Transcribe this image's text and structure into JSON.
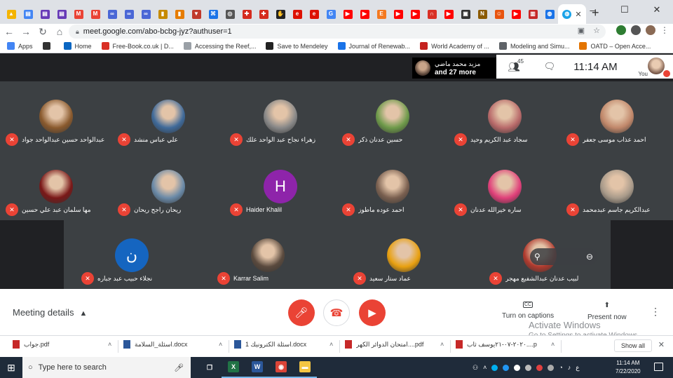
{
  "browser": {
    "tab_favicons": [
      {
        "icon": "drive-icon",
        "color": "#f4b400",
        "char": "▲"
      },
      {
        "icon": "form-icon",
        "color": "#4285f4",
        "char": "▤"
      },
      {
        "icon": "forms-icon",
        "color": "#673ab7",
        "char": "▤"
      },
      {
        "icon": "forms-icon",
        "color": "#673ab7",
        "char": "▤"
      },
      {
        "icon": "gmail-icon",
        "color": "#ea4335",
        "char": "M"
      },
      {
        "icon": "gmail-icon",
        "color": "#ea4335",
        "char": "M"
      },
      {
        "icon": "meet-link-icon",
        "color": "#4a67d6",
        "char": "∞"
      },
      {
        "icon": "meet-link-icon",
        "color": "#4a67d6",
        "char": "∞"
      },
      {
        "icon": "meet-link-icon",
        "color": "#4a67d6",
        "char": "∞"
      },
      {
        "icon": "slides-icon",
        "color": "#c68a00",
        "char": "▮"
      },
      {
        "icon": "bars-icon",
        "color": "#e67c00",
        "char": "▮"
      },
      {
        "icon": "shield-icon",
        "color": "#c0392b",
        "char": "▼"
      },
      {
        "icon": "grid-icon",
        "color": "#1a73e8",
        "char": "⌘"
      },
      {
        "icon": "globe-icon",
        "color": "#555555",
        "char": "◎"
      },
      {
        "icon": "canada-flag-icon",
        "color": "#d52b1e",
        "char": "✚"
      },
      {
        "icon": "canada-flag-icon",
        "color": "#d52b1e",
        "char": "✚"
      },
      {
        "icon": "hand-icon",
        "color": "#222222",
        "char": "✋"
      },
      {
        "icon": "wolfram-icon",
        "color": "#dd1100",
        "char": "e"
      },
      {
        "icon": "wolfram-icon",
        "color": "#dd1100",
        "char": "e"
      },
      {
        "icon": "google-icon",
        "color": "#4285f4",
        "char": "G"
      },
      {
        "icon": "youtube-icon",
        "color": "#ff0000",
        "char": "▶"
      },
      {
        "icon": "youtube-icon",
        "color": "#ff0000",
        "char": "▶"
      },
      {
        "icon": "elsevier-icon",
        "color": "#f47920",
        "char": "E"
      },
      {
        "icon": "youtube-icon",
        "color": "#ff0000",
        "char": "▶"
      },
      {
        "icon": "youtube-icon",
        "color": "#ff0000",
        "char": "▶"
      },
      {
        "icon": "arch-icon",
        "color": "#d93025",
        "char": "∩"
      },
      {
        "icon": "youtube-icon",
        "color": "#ff0000",
        "char": "▶"
      },
      {
        "icon": "lock-icon",
        "color": "#333333",
        "char": "▣"
      },
      {
        "icon": "n-icon",
        "color": "#8b5a00",
        "char": "N"
      },
      {
        "icon": "face-icon",
        "color": "#e8540f",
        "char": "☺"
      },
      {
        "icon": "youtube-icon",
        "color": "#ff0000",
        "char": "▶"
      },
      {
        "icon": "book-icon",
        "color": "#c62828",
        "char": "▥"
      },
      {
        "icon": "globe-icon",
        "color": "#1a73e8",
        "char": "◍"
      }
    ],
    "active_tab_favicon": {
      "icon": "chrome-globe-icon",
      "color": "#1aa3e8",
      "char": "◍"
    },
    "url": "meet.google.com/abo-bcbg-jyz?authuser=1",
    "bookmarks": [
      {
        "label": "Apps",
        "icon": "apps-icon",
        "color": "#4285f4"
      },
      {
        "label": "",
        "icon": "world-icon",
        "color": "#333333"
      },
      {
        "label": "Home",
        "icon": "linkedin-icon",
        "color": "#0a66c2"
      },
      {
        "label": "Free-Book.co.uk | D...",
        "icon": "star-icon",
        "color": "#d93025"
      },
      {
        "label": "Accessing the Reef,...",
        "icon": "page-icon",
        "color": "#9aa0a6"
      },
      {
        "label": "Save to Mendeley",
        "icon": "mendeley-icon",
        "color": "#222222"
      },
      {
        "label": "Journal of Renewab...",
        "icon": "journal-icon",
        "color": "#1a73e8"
      },
      {
        "label": "World Academy of ...",
        "icon": "w-icon",
        "color": "#c5221f"
      },
      {
        "label": "Modeling and Simu...",
        "icon": "doc-icon",
        "color": "#5f6368"
      },
      {
        "label": "OATD – Open Acce...",
        "icon": "oatd-icon",
        "color": "#e37400"
      }
    ]
  },
  "meet": {
    "more_participants": {
      "name": "مزيد محمد ماضي",
      "more": "and 27 more"
    },
    "people_count": "45",
    "time": "11:14 AM",
    "you_label": "You",
    "tiles": [
      {
        "name": "احمد عذاب موسى جعفر",
        "initial": "",
        "color": "#c0876a"
      },
      {
        "name": "سجاد عبد الكريم وحيد",
        "initial": "",
        "color": "#b86a6a"
      },
      {
        "name": "حسين عدنان ذكر",
        "initial": "",
        "color": "#6e9a4a"
      },
      {
        "name": "زهراء نجاح عبد الواحد علك",
        "initial": "",
        "color": "#888888"
      },
      {
        "name": "علي عباس منشد",
        "initial": "",
        "color": "#3f6a9a"
      },
      {
        "name": "عبدالواحد حسين عبدالواحد جواد",
        "initial": "",
        "color": "#8a5a2e"
      },
      {
        "name": "عبدالكريم جاسم عبدمحمد",
        "initial": "",
        "color": "#a89a8a"
      },
      {
        "name": "ساره خيرالله عدنان",
        "initial": "",
        "color": "#e0407a"
      },
      {
        "name": "احمد عوده ماطوز",
        "initial": "",
        "color": "#7a6050"
      },
      {
        "name": "Haider Khalil",
        "initial": "H",
        "color": "#8e24aa"
      },
      {
        "name": "ريحان راجح ريحان",
        "initial": "",
        "color": "#6a8aa8"
      },
      {
        "name": "مها سلمان عبد علي حسين",
        "initial": "",
        "color": "#7a1818"
      },
      {
        "name": "لبيب عدنان عبدالشفيع مهجر",
        "initial": "",
        "color": "#b03a2e"
      },
      {
        "name": "عماد ستار سعيد",
        "initial": "",
        "color": "#e8a010"
      },
      {
        "name": "Karrar Salim",
        "initial": "",
        "color": "#5a4a3e"
      },
      {
        "name": "نجلاء حبيب عبد جباره",
        "initial": "ن",
        "color": "#1565c0"
      }
    ],
    "meeting_details": "Meeting details",
    "turn_on_captions": "Turn on captions",
    "present_now": "Present now",
    "cc_label": "CC",
    "activate_title": "Activate Windows",
    "activate_sub": "Go to Settings to activate Windows."
  },
  "downloads": [
    {
      "name": "جواب.pdf",
      "type": "pdf",
      "color": "#c62828"
    },
    {
      "name": "اسئلة_السلامة.docx",
      "type": "docx",
      "color": "#2b579a"
    },
    {
      "name": "اسئلة الكترونيك 1.docx",
      "type": "docx",
      "color": "#2b579a"
    },
    {
      "name": "امتحان الدوائر الكهر....pdf",
      "type": "pdf",
      "color": "#c62828"
    },
    {
      "name": "٢٠٢٠-٠٧-٢١يوسف ثاب....pdf",
      "type": "pdf",
      "color": "#c62828"
    }
  ],
  "show_all": "Show all",
  "taskbar": {
    "search_placeholder": "Type here to search",
    "apps": [
      {
        "icon": "task-view-icon",
        "color": "#ffffff",
        "char": "❐"
      },
      {
        "icon": "excel-icon",
        "color": "#217346",
        "char": "X"
      },
      {
        "icon": "word-icon",
        "color": "#2b579a",
        "char": "W"
      },
      {
        "icon": "chrome-icon",
        "color": "#db4437",
        "char": "◉"
      },
      {
        "icon": "file-explorer-icon",
        "color": "#f4c542",
        "char": "▬"
      }
    ],
    "time": "11:14 AM",
    "date": "7/22/2020",
    "lang": "ع"
  }
}
